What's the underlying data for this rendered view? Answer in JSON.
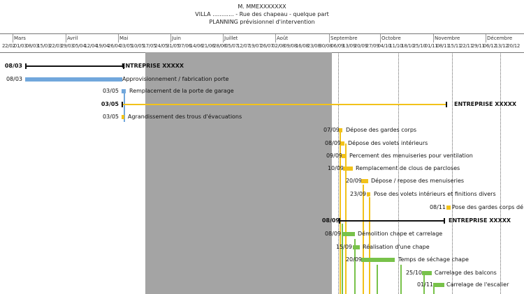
{
  "header": {
    "owner": "M. MMEXXXXXXX",
    "address": "VILLA ............ - Rue des chapeau  - quelque part",
    "title": "PLANNING prévisionnel d'intervention"
  },
  "timeline": {
    "months": [
      "Mars",
      "Avril",
      "Mai",
      "Juin",
      "Juillet",
      "Août",
      "Septembre",
      "Octobre",
      "Novembre",
      "Décembre"
    ],
    "weeks": [
      "22/02",
      "01/03",
      "08/03",
      "15/03",
      "22/03",
      "29/03",
      "05/04",
      "12/04",
      "19/04",
      "26/04",
      "03/05",
      "10/05",
      "17/05",
      "24/05",
      "31/05",
      "07/06",
      "14/06",
      "21/06",
      "28/06",
      "05/07",
      "12/07",
      "19/07",
      "26/07",
      "02/08",
      "09/08",
      "16/08",
      "23/08",
      "30/08",
      "06/09",
      "13/09",
      "20/09",
      "27/09",
      "04/10",
      "11/10",
      "18/10",
      "25/10",
      "01/11",
      "08/11",
      "15/11",
      "22/11",
      "29/11",
      "06/12",
      "13/12",
      "20/12"
    ]
  },
  "tasks": [
    {
      "date": "08/03",
      "label": "ENTREPRISE XXXXX",
      "summary": true
    },
    {
      "date": "08/03",
      "label": "Approvisionnement / fabrication porte",
      "summary": false
    },
    {
      "date": "03/05",
      "label": "Remplacement de la porte de garage",
      "summary": false
    },
    {
      "date": "03/05",
      "label": "ENTREPRISE XXXXX",
      "summary": true
    },
    {
      "date": "03/05",
      "label": "Agrandissement des trous d'évacuations",
      "summary": false
    },
    {
      "date": "07/09",
      "label": "Dépose des gardes corps",
      "summary": false
    },
    {
      "date": "08/09",
      "label": "Dépose des volets intérieurs",
      "summary": false
    },
    {
      "date": "09/09",
      "label": "Percement des menuiseries pour ventilation",
      "summary": false
    },
    {
      "date": "10/09",
      "label": "Remplacement de clous de parcloses",
      "summary": false
    },
    {
      "date": "20/09",
      "label": "Dépose / repose des menuiseries",
      "summary": false
    },
    {
      "date": "23/09",
      "label": "Pose des volets intérieurs et finitions divers",
      "summary": false
    },
    {
      "date": "08/11",
      "label": "Pose des gardes corps dé",
      "summary": false
    },
    {
      "date": "08/09",
      "label": "ENTREPRISE XXXXX",
      "summary": true
    },
    {
      "date": "08/09",
      "label": "Démolition chape et carrelage",
      "summary": false
    },
    {
      "date": "15/09",
      "label": "Réalisation d'une chape",
      "summary": false
    },
    {
      "date": "20/09",
      "label": "Temps de séchage chape",
      "summary": false
    },
    {
      "date": "25/10",
      "label": "Carrelage des balcons",
      "summary": false
    },
    {
      "date": "01/11",
      "label": "Carrelage de l'escalier",
      "summary": false
    }
  ],
  "colors": {
    "blue": "#71a7dc",
    "yellow": "#f2c21a",
    "green": "#78c24a",
    "shade": "#a4a4a4"
  }
}
